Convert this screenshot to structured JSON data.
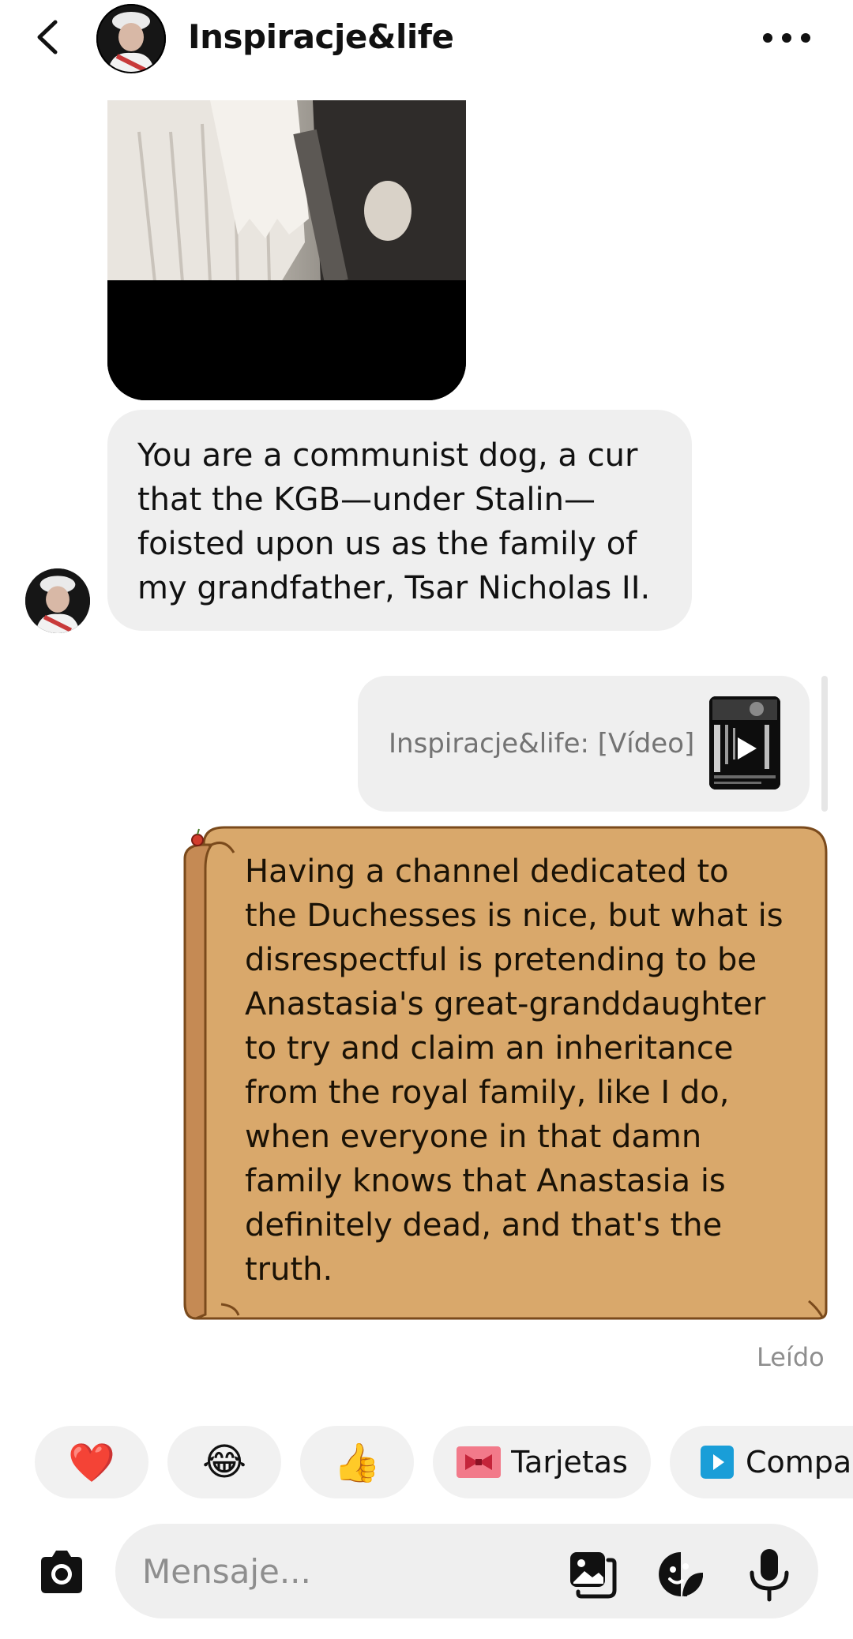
{
  "header": {
    "title": "Inspiracje&life",
    "back_icon": "chevron-left-icon",
    "more_icon": "more-horizontal-icon"
  },
  "messages": {
    "incoming_text": "You are a communist dog, a cur that the KGB—under Stalin—foisted upon us as the family of my grandfather, Tsar Nicholas II.",
    "shared_video_label": "Inspiracje&life: [Vídeo]",
    "outgoing_scroll_lines": [
      "Having a channel dedicated to",
      "the Duchesses is nice, but what is",
      "disrespectful is pretending to be",
      "Anastasia's great-granddaughter",
      "to try and claim an inheritance",
      "from the royal family, like I do,",
      "when everyone in that damn",
      "family knows that Anastasia is",
      "definitely dead, and that's the",
      "truth."
    ],
    "read_status": "Leído"
  },
  "quick_replies": {
    "heart": "❤️",
    "laugh": "😂",
    "thumbs": "👍",
    "cards_label": "Tarjetas",
    "share_label": "Compa"
  },
  "composer": {
    "placeholder": "Mensaje..."
  },
  "colors": {
    "bubble_gray": "#efefef",
    "scroll_fill": "#d9a86b",
    "scroll_edge": "#7a4a1c",
    "scroll_roll": "#c58a54"
  }
}
